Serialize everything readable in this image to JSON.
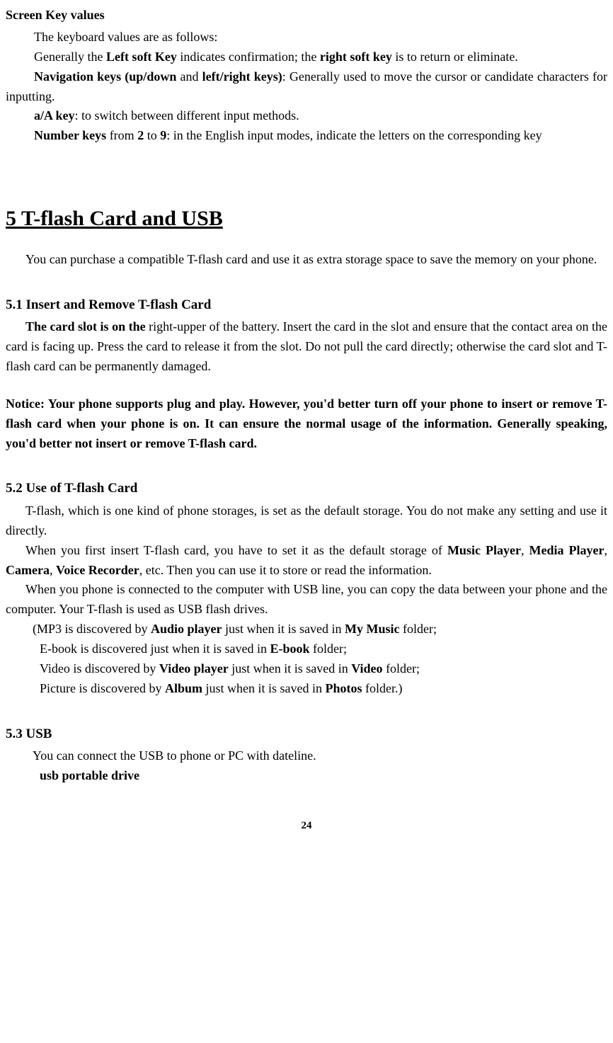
{
  "screen_keys": {
    "title": "Screen Key values",
    "intro": "The keyboard values are as follows:",
    "soft_key_line": "Generally the Left soft Key indicates confirmation; the right soft key is to return or eliminate.",
    "soft_key_pre": "Generally the ",
    "left_soft_key_bold": "Left soft Key",
    "soft_key_mid": " indicates confirmation; the ",
    "right_soft_key_bold": "right soft key",
    "soft_key_end": " is to return or eliminate.",
    "nav_keys_bold1": "Navigation keys (up/down",
    "nav_keys_mid": " and ",
    "nav_keys_bold2": "left/right keys)",
    "nav_keys_end": ": Generally used to move the cursor or candidate characters for inputting.",
    "aA_bold": "a/A key",
    "aA_end": ": to switch between different input methods.",
    "num_bold1": "Number keys",
    "num_mid1": " from ",
    "num_bold2": "2",
    "num_mid2": " to ",
    "num_bold3": "9",
    "num_end": ": in the English input modes, indicate the letters on the corresponding key"
  },
  "chapter": {
    "title": "5 T-flash Card and USB",
    "intro": "You can purchase a compatible T-flash card and use it as extra storage space to save the memory on your phone."
  },
  "section51": {
    "title": "5.1 Insert and Remove T-flash Card",
    "bold_lead": "The card slot is on the ",
    "body": "right-upper of the battery. Insert the card in the slot and ensure that the contact area on the card is facing up. Press the card to release it from the slot. Do not pull the card directly; otherwise the card slot and T-flash card can be permanently damaged.",
    "notice": "Notice: Your phone supports plug and play. However, you'd better turn off your phone to insert or remove T-flash card when your phone is on. It can ensure the normal usage of the information. Generally speaking, you'd better not insert or remove T-flash card."
  },
  "section52": {
    "title": "5.2 Use of T-flash Card",
    "p1": "T-flash, which is one kind of phone storages, is set as the default storage. You do not make any setting and use it directly.",
    "p2_pre": "When you first insert T-flash card, you have to set it as the default storage of ",
    "p2_music": "Music Player",
    "p2_c1": ", ",
    "p2_media": "Media Player",
    "p2_c2": ", ",
    "p2_camera": "Camera",
    "p2_c3": ", ",
    "p2_voice": "Voice Recorder",
    "p2_end": ", etc. Then you can use it to store or read the information.",
    "p3": "When you phone is connected to the computer with USB line, you can copy the data between your phone and the computer. Your T-flash is used as USB flash drives.",
    "li1_pre": "(MP3 is discovered by ",
    "li1_b1": "Audio player",
    "li1_mid": " just when it is saved in ",
    "li1_b2": "My Music",
    "li1_end": " folder;",
    "li2_pre": "E-book is discovered just when it is saved in ",
    "li2_b1": "E-book",
    "li2_end": " folder;",
    "li3_pre": "Video is discovered by ",
    "li3_b1": "Video player",
    "li3_mid": " just when it is saved in ",
    "li3_b2": "Video",
    "li3_end": " folder;",
    "li4_pre": "Picture is discovered by ",
    "li4_b1": "Album",
    "li4_mid": " just when it is saved in ",
    "li4_b2": "Photos",
    "li4_end": " folder.)"
  },
  "section53": {
    "title": "5.3 USB",
    "p1": "You can connect the USB to phone or PC with dateline.",
    "p2": "usb portable drive"
  },
  "page_number": "24"
}
